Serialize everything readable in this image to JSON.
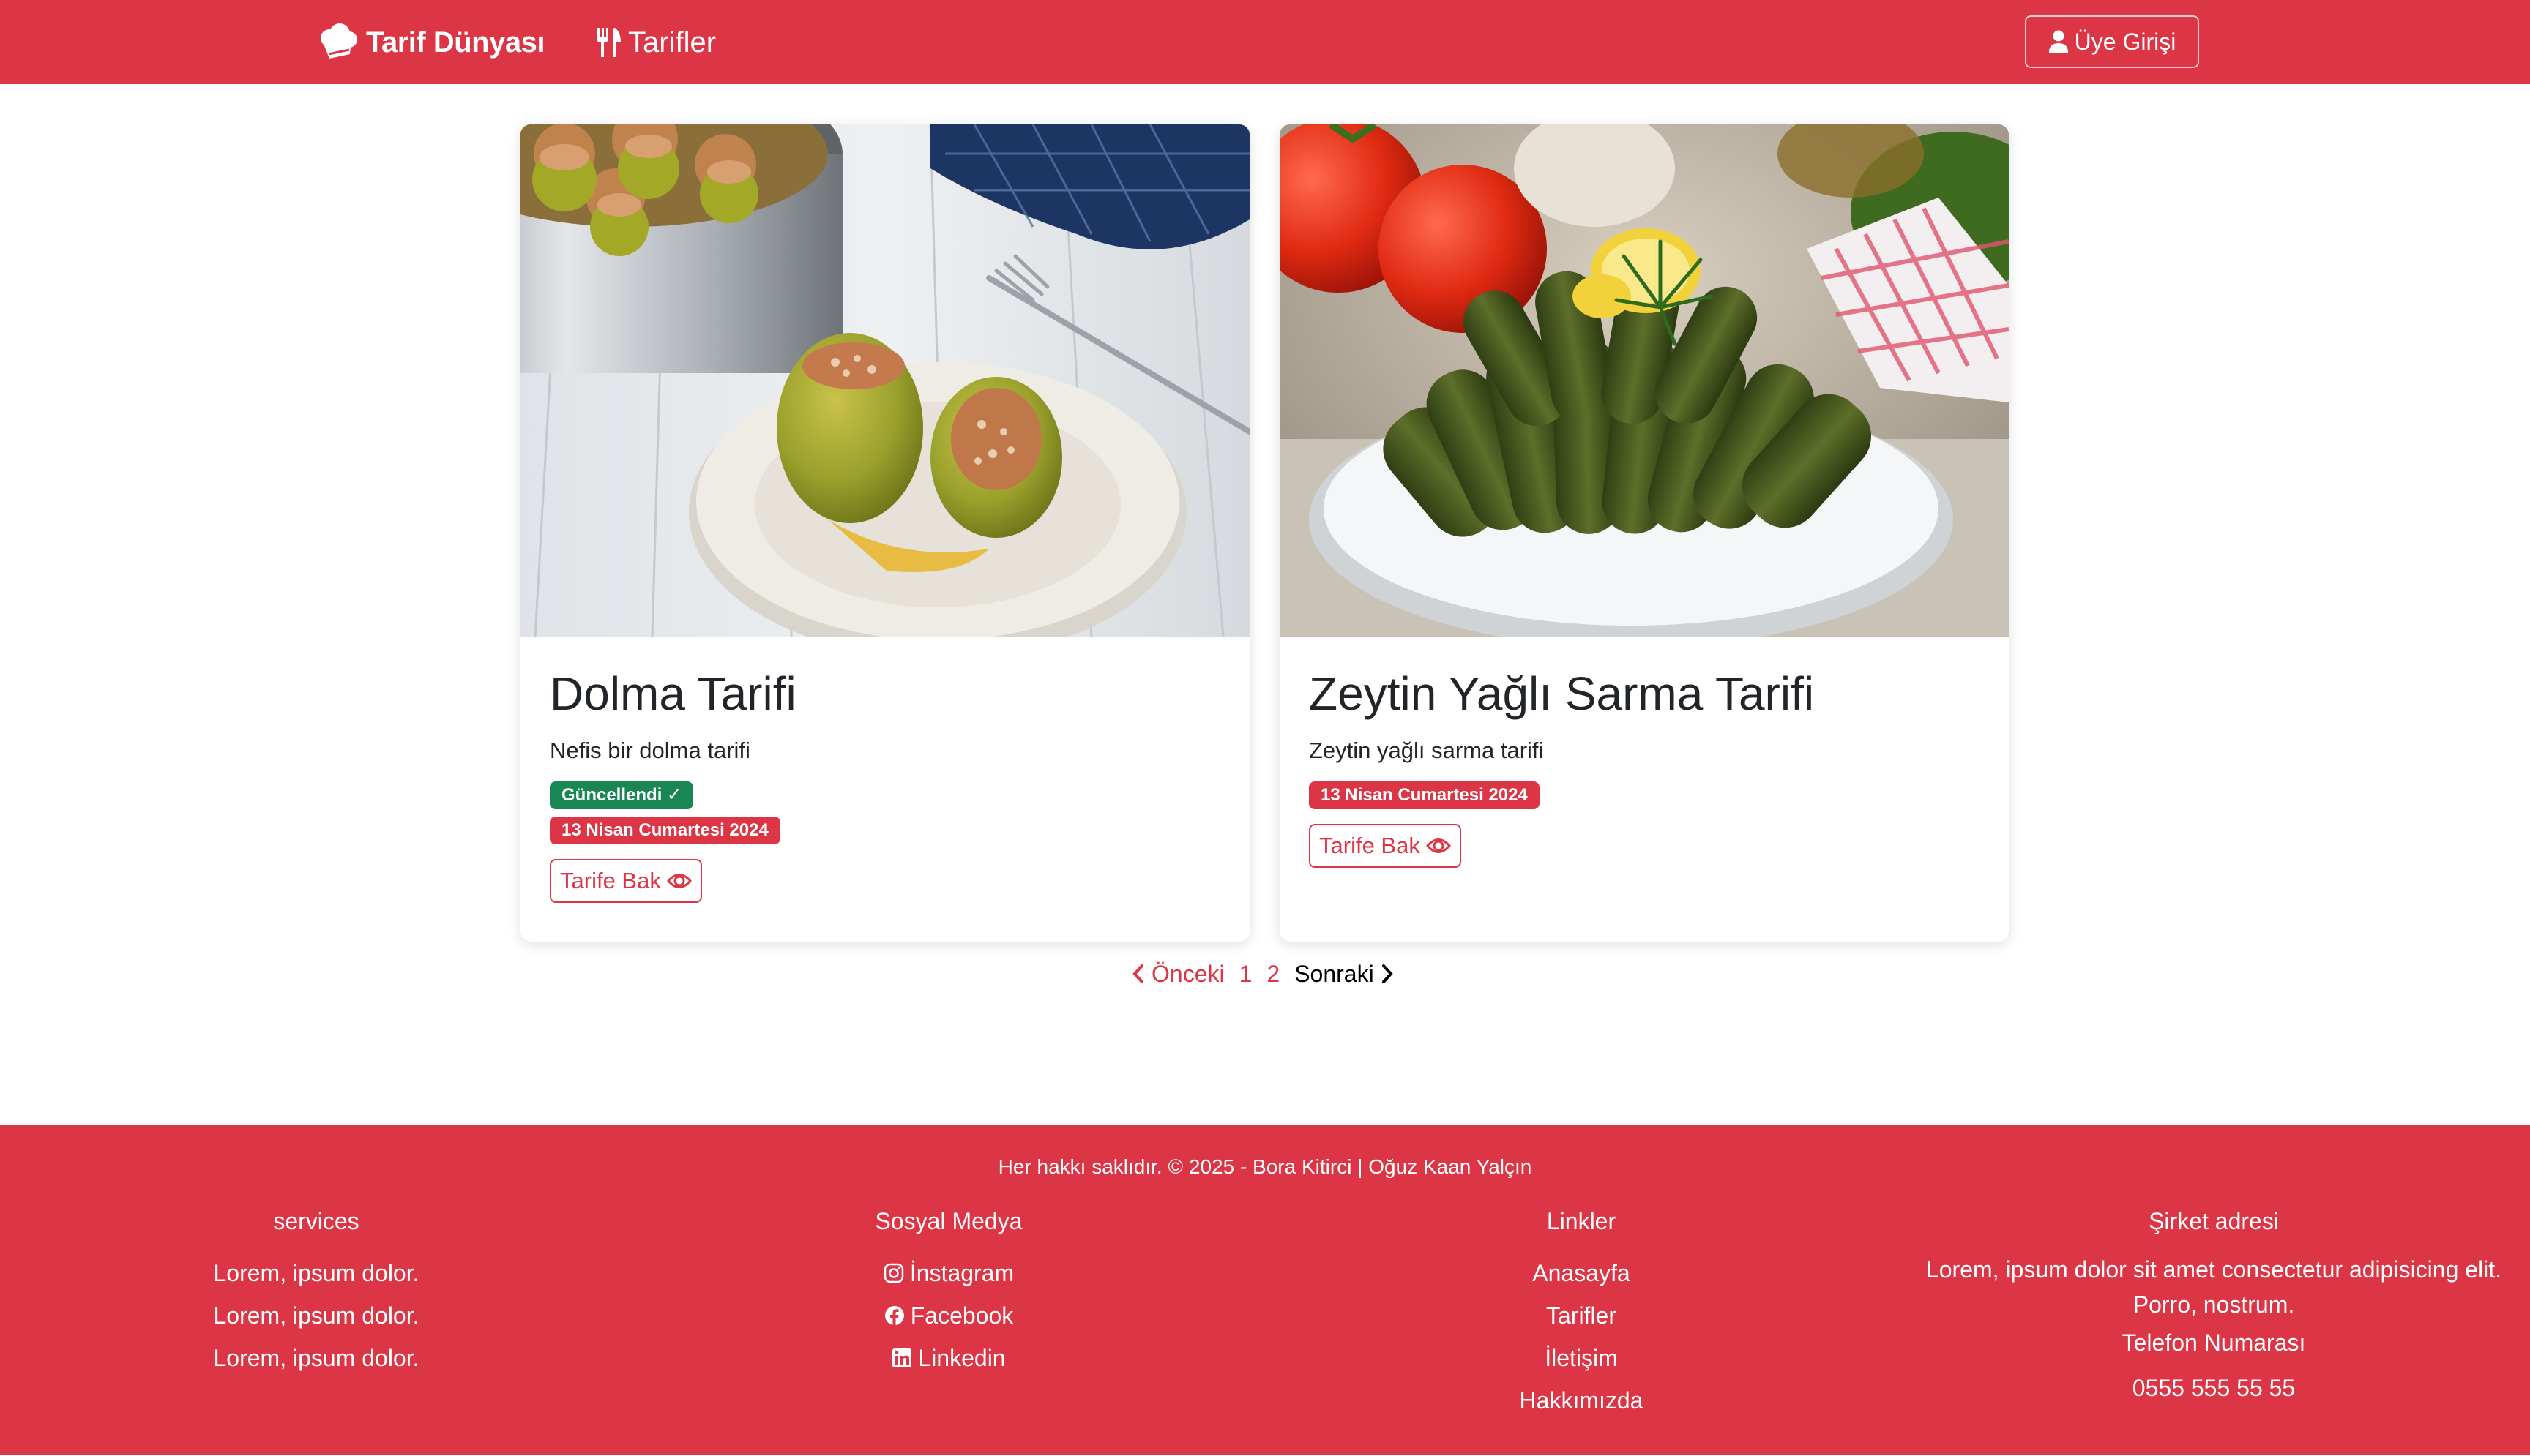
{
  "nav": {
    "brand": "Tarif Dünyası",
    "recipes_link": "Tarifler",
    "login": "Üye Girişi",
    "brand_color": "#dc3545"
  },
  "cards": [
    {
      "title": "Dolma Tarifi",
      "text": "Nefis bir dolma tarifi",
      "updated_badge": "Güncellendi ✓",
      "date_badge": "13 Nisan Cumartesi 2024",
      "button": "Tarife Bak",
      "image_icon": "stuffed-peppers-photo"
    },
    {
      "title": "Zeytin Yağlı Sarma Tarifi",
      "text": "Zeytin yağlı sarma tarifi",
      "date_badge": "13 Nisan Cumartesi 2024",
      "button": "Tarife Bak",
      "image_icon": "grape-leaf-rolls-photo"
    }
  ],
  "pagination": {
    "prev": "Önceki",
    "pages": [
      "1",
      "2"
    ],
    "next": "Sonraki"
  },
  "footer": {
    "copyright": "Her hakkı saklıdır. © 2025 - Bora Kitirci | Oğuz Kaan Yalçın",
    "services": {
      "heading": "services",
      "items": [
        "Lorem, ipsum dolor.",
        "Lorem, ipsum dolor.",
        "Lorem, ipsum dolor."
      ]
    },
    "social": {
      "heading": "Sosyal Medya",
      "items": [
        "İnstagram",
        "Facebook",
        "Linkedin"
      ]
    },
    "links": {
      "heading": "Linkler",
      "items": [
        "Anasayfa",
        "Tarifler",
        "İletişim",
        "Hakkımızda"
      ]
    },
    "company": {
      "heading": "Şirket adresi",
      "address_line1": "Lorem, ipsum dolor sit amet consectetur adipisicing elit.",
      "address_line2": "Porro, nostrum.",
      "phone_heading": "Telefon Numarası",
      "phone": "0555 555 55 55"
    }
  }
}
